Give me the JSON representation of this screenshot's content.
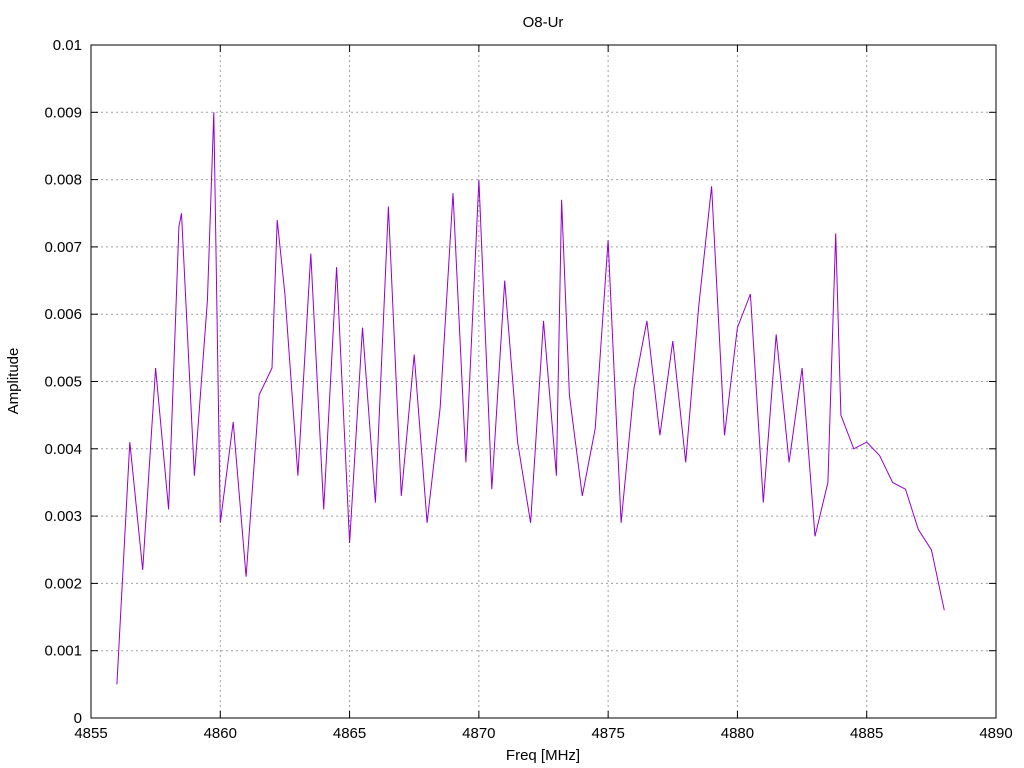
{
  "chart_data": {
    "type": "line",
    "title": "O8-Ur",
    "xlabel": "Freq [MHz]",
    "ylabel": "Amplitude",
    "xlim": [
      4855,
      4890
    ],
    "ylim": [
      0,
      0.01
    ],
    "xticks": [
      4855,
      4860,
      4865,
      4870,
      4875,
      4880,
      4885,
      4890
    ],
    "yticks": [
      0,
      0.001,
      0.002,
      0.003,
      0.004,
      0.005,
      0.006,
      0.007,
      0.008,
      0.009,
      0.01
    ],
    "xtick_labels": [
      "4855",
      "4860",
      "4865",
      "4870",
      "4875",
      "4880",
      "4885",
      "4890"
    ],
    "ytick_labels": [
      "0",
      "0.001",
      "0.002",
      "0.003",
      "0.004",
      "0.005",
      "0.006",
      "0.007",
      "0.008",
      "0.009",
      "0.01"
    ],
    "grid": true,
    "series_color": "#9400d3",
    "series": [
      {
        "x": [
          4856.0,
          4856.5,
          4857.0,
          4857.5,
          4858.0,
          4858.4,
          4858.5,
          4859.0,
          4859.5,
          4859.75,
          4860.0,
          4860.5,
          4861.0,
          4861.5,
          4862.0,
          4862.2,
          4862.5,
          4863.0,
          4863.5,
          4864.0,
          4864.5,
          4865.0,
          4865.5,
          4866.0,
          4866.5,
          4867.0,
          4867.5,
          4868.0,
          4868.5,
          4869.0,
          4869.5,
          4870.0,
          4870.5,
          4871.0,
          4871.5,
          4872.0,
          4872.5,
          4873.0,
          4873.2,
          4873.5,
          4874.0,
          4874.5,
          4875.0,
          4875.5,
          4876.0,
          4876.5,
          4877.0,
          4877.5,
          4878.0,
          4878.5,
          4879.0,
          4879.5,
          4880.0,
          4880.5,
          4881.0,
          4881.5,
          4882.0,
          4882.5,
          4883.0,
          4883.5,
          4883.8,
          4884.0,
          4884.5,
          4885.0,
          4885.5,
          4886.0,
          4886.5,
          4887.0,
          4887.5,
          4888.0
        ],
        "y": [
          0.0005,
          0.0041,
          0.0022,
          0.0052,
          0.0031,
          0.0073,
          0.0075,
          0.0036,
          0.0062,
          0.009,
          0.0029,
          0.0044,
          0.0021,
          0.0048,
          0.0052,
          0.0074,
          0.0063,
          0.0036,
          0.0069,
          0.0031,
          0.0067,
          0.0026,
          0.0058,
          0.0032,
          0.0076,
          0.0033,
          0.0054,
          0.0029,
          0.0046,
          0.0078,
          0.0038,
          0.008,
          0.0034,
          0.0065,
          0.0041,
          0.0029,
          0.0059,
          0.0036,
          0.0077,
          0.0048,
          0.0033,
          0.0043,
          0.0071,
          0.0029,
          0.0049,
          0.0059,
          0.0042,
          0.0056,
          0.0038,
          0.0061,
          0.0079,
          0.0042,
          0.0058,
          0.0063,
          0.0032,
          0.0057,
          0.0038,
          0.0052,
          0.0027,
          0.0035,
          0.0072,
          0.0045,
          0.004,
          0.0041,
          0.0039,
          0.0035,
          0.0034,
          0.0028,
          0.0025,
          0.0016
        ]
      }
    ]
  }
}
